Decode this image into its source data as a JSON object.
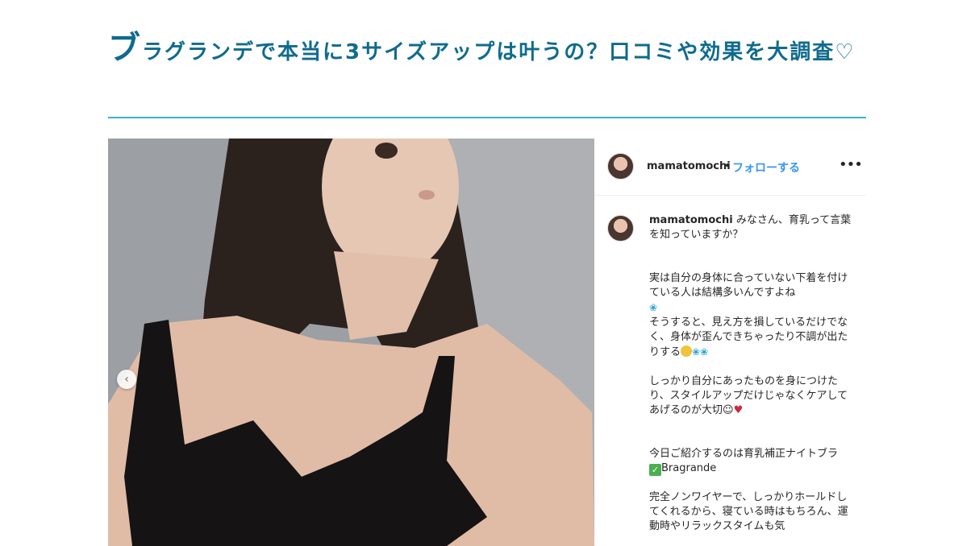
{
  "article": {
    "title_first_char": "ブ",
    "title_rest": "ラグランデで本当に3サイズアップは叶うの？口コミや効果を大調査♡"
  },
  "colors": {
    "title": "#0f6b8e",
    "rule": "#3bb3d0",
    "follow": "#3897f0"
  },
  "post": {
    "prev_icon": "chevron-left-icon",
    "prev_glyph": "‹",
    "header": {
      "username": "mamatomochi",
      "separator": "•",
      "follow_label": "フォローする",
      "more_glyph": "•••"
    },
    "caption": {
      "username": "mamatomochi",
      "intro": "みなさん、育乳って言葉を知っていますか？",
      "p1_line1": "実は自分の身体に合っていない下着を付けている人は結構多いんですよね",
      "p1_line2": "そうすると、見え方を損しているだけでなく、身体が歪んできちゃったり不調が出たりする",
      "p2": "しっかり自分にあったものを身につけたり、スタイルアップだけじゃなくケアしてあげるのが大切",
      "p3": "今日ご紹介するのは育乳補正ナイトブラ",
      "brand": "Bragrande",
      "p4": "完全ノンワイヤーで、しっかりホールドしてくれるから、寝ている時はもちろん、運動時やリラックスタイムも気"
    }
  }
}
